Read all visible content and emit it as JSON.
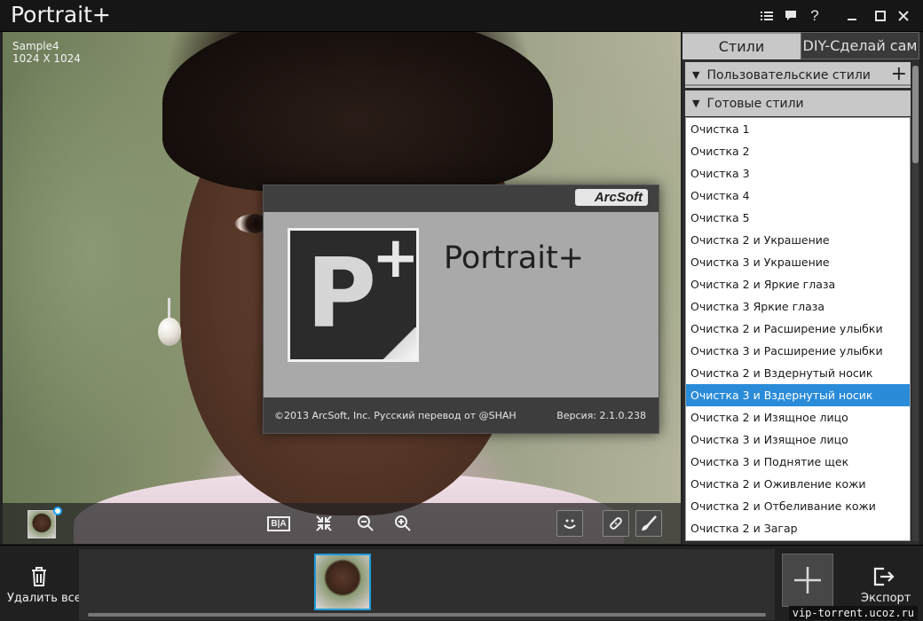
{
  "app": {
    "title": "Portrait+"
  },
  "titlebar": {
    "icons": [
      "list-icon",
      "comment-icon",
      "help-icon",
      "minimize-icon",
      "maximize-icon",
      "close-icon"
    ],
    "help_glyph": "?"
  },
  "photo": {
    "name": "Sample4",
    "dimensions": "1024 X 1024"
  },
  "photo_toolbar": {
    "ba_label": "B|A",
    "icons": [
      "before-after-icon",
      "fit-icon",
      "zoom-out-icon",
      "zoom-in-icon",
      "smile-icon",
      "bandage-icon",
      "brush-icon"
    ]
  },
  "about": {
    "brand": "ArcSoft",
    "product": "Portrait+",
    "copyright": "©2013 ArcSoft, Inc. Русский перевод от @SHAH",
    "version": "Версия: 2.1.0.238"
  },
  "panel": {
    "tabs": [
      "Стили",
      "DIY-Сделай сам"
    ],
    "sections": {
      "custom": "Пользовательские стили",
      "ready": "Готовые стили"
    },
    "styles": [
      "Очистка 1",
      "Очистка 2",
      "Очистка 3",
      "Очистка 4",
      "Очистка 5",
      "Очистка 2 и Украшение",
      "Очистка 3 и Украшение",
      "Очистка 2 и Яркие глаза",
      "Очистка 3 Яркие глаза",
      "Очистка 2 и Расширение улыбки",
      "Очистка 3 и Расширение улыбки",
      "Очистка 2 и Вздернутый носик",
      "Очистка 3 и Вздернутый носик",
      "Очистка 2 и Изящное лицо",
      "Очистка 3 и Изящное лицо",
      "Очистка 3 и Поднятие щек",
      "Очистка 2 и Оживление кожи",
      "Очистка 2 и Отбеливание кожи",
      "Очистка 2 и Загар"
    ],
    "selected_index": 12
  },
  "bottom": {
    "delete_all": "Удалить все",
    "export": "Экспорт",
    "watermark": "vip-torrent.ucoz.ru"
  },
  "colors": {
    "accent": "#2a8bd8",
    "panel_bg": "#c8c8c8",
    "arcsoft_red": "#c4161c"
  }
}
